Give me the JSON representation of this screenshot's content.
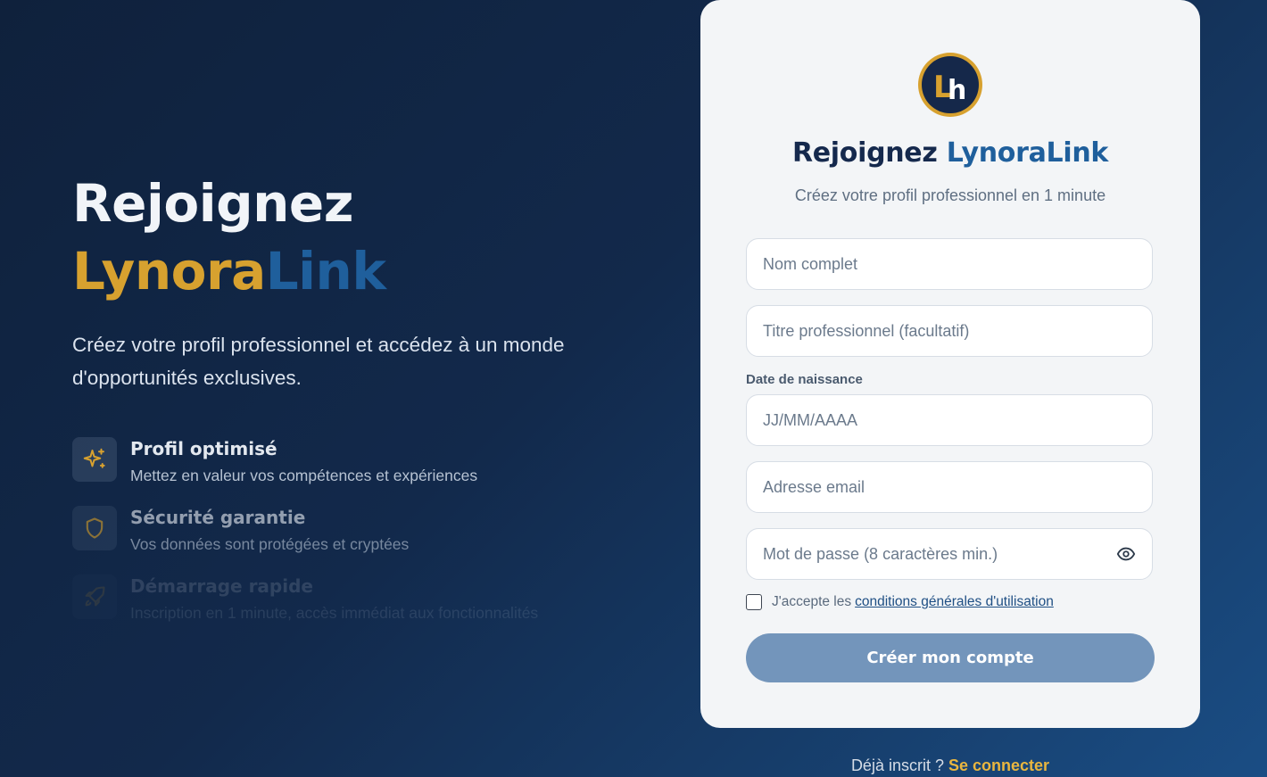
{
  "hero": {
    "title_line1": "Rejoignez",
    "title_brand_part1": "Lynora",
    "title_brand_part2": "Link",
    "description": "Créez votre profil professionnel et accédez à un monde d'opportunités exclusives.",
    "features": [
      {
        "icon": "sparkles-icon",
        "title": "Profil optimisé",
        "description": "Mettez en valeur vos compétences et expériences"
      },
      {
        "icon": "shield-icon",
        "title": "Sécurité garantie",
        "description": "Vos données sont protégées et cryptées"
      },
      {
        "icon": "rocket-icon",
        "title": "Démarrage rapide",
        "description": "Inscription en 1 minute, accès immédiat aux fonctionnalités"
      }
    ]
  },
  "card": {
    "logo_text": "Lh",
    "title_prefix": "Rejoignez",
    "title_brand": "LynoraLink",
    "subtitle": "Créez votre profil professionnel en 1 minute",
    "fields": {
      "full_name": {
        "placeholder": "Nom complet",
        "value": ""
      },
      "job_title": {
        "placeholder": "Titre professionnel (facultatif)",
        "value": ""
      },
      "birth_date_label": "Date de naissance",
      "birth_date": {
        "placeholder": "JJ/MM/AAAA",
        "value": ""
      },
      "email": {
        "placeholder": "Adresse email",
        "value": ""
      },
      "password": {
        "placeholder": "Mot de passe (8 caractères min.)",
        "value": ""
      }
    },
    "terms_prefix": "J'accepte les",
    "terms_link": "conditions générales d'utilisation",
    "terms_checked": false,
    "submit_label": "Créer mon compte"
  },
  "login": {
    "prefix": "Déjà inscrit ?",
    "link": "Se connecter"
  },
  "colors": {
    "gold": "#d7a12f",
    "brand_blue": "#1f5f9c",
    "navy": "#15294d",
    "button": "#7395bb"
  }
}
